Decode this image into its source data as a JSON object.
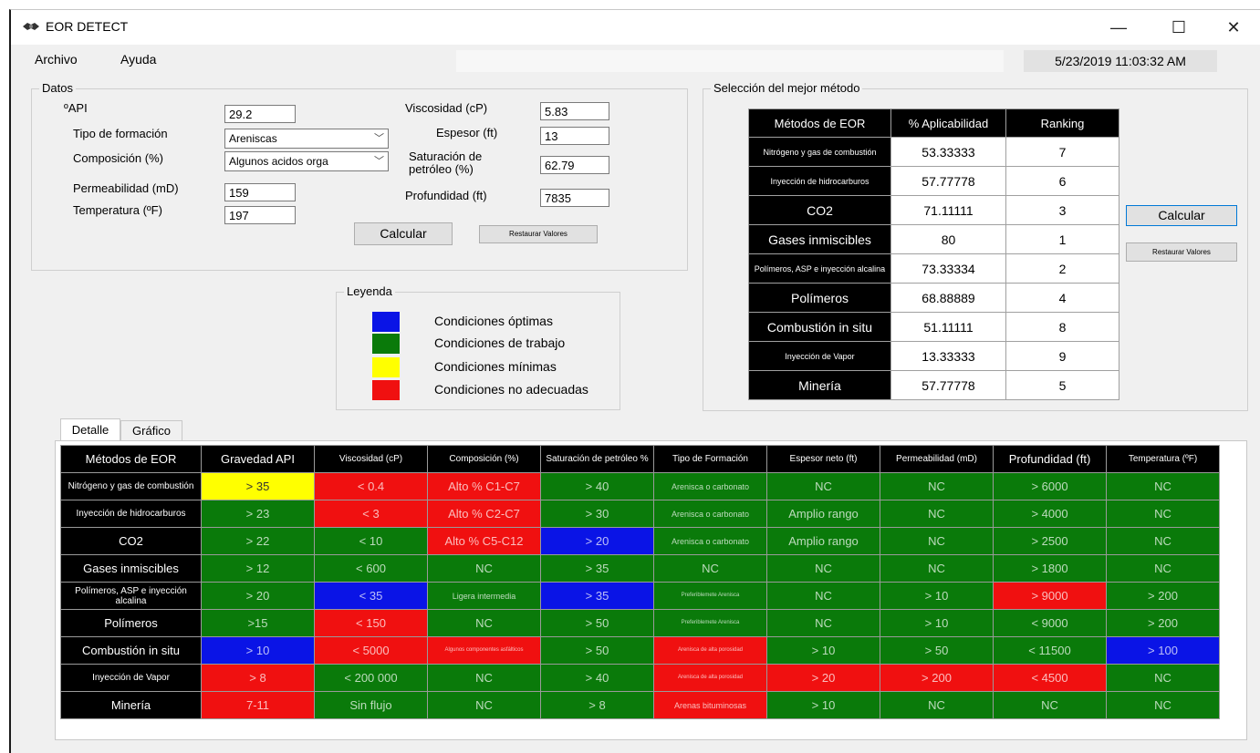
{
  "window": {
    "title": "EOR DETECT",
    "minimize": "—",
    "maximize": "☐",
    "close": "✕"
  },
  "menu": {
    "archivo": "Archivo",
    "ayuda": "Ayuda"
  },
  "datetime": "5/23/2019 11:03:32 AM",
  "datos": {
    "title": "Datos",
    "api_label": "ºAPI",
    "api_value": "29.2",
    "tipo_label": "Tipo de formación",
    "tipo_value": "Areniscas",
    "comp_label": "Composición (%)",
    "comp_value": "Algunos acidos orga",
    "perm_label": "Permeabilidad (mD)",
    "perm_value": "159",
    "temp_label": "Temperatura (ºF)",
    "temp_value": "197",
    "visc_label": "Viscosidad (cP)",
    "visc_value": "5.83",
    "esp_label": "Espesor (ft)",
    "esp_value": "13",
    "sat_label_1": "Saturación de",
    "sat_label_2": "petróleo (%)",
    "sat_value": "62.79",
    "prof_label": "Profundidad (ft)",
    "prof_value": "7835",
    "calcular": "Calcular",
    "restaurar": "Restaurar Valores"
  },
  "leyenda": {
    "title": "Leyenda",
    "items": [
      {
        "color": "#0a14e6",
        "label": "Condiciones óptimas"
      },
      {
        "color": "#0a7a0a",
        "label": "Condiciones de trabajo"
      },
      {
        "color": "#ffff00",
        "label": "Condiciones mínimas"
      },
      {
        "color": "#f01010",
        "label": "Condiciones no adecuadas"
      }
    ]
  },
  "seleccion": {
    "title": "Selección del mejor método",
    "headers": [
      "Métodos de EOR",
      "% Aplicabilidad",
      "Ranking"
    ],
    "rows": [
      {
        "method": "Nitrógeno y gas de combustión",
        "pct": "53.33333",
        "rank": "7",
        "small": true
      },
      {
        "method": "Inyección de hidrocarburos",
        "pct": "57.77778",
        "rank": "6",
        "small": true
      },
      {
        "method": "CO2",
        "pct": "71.11111",
        "rank": "3",
        "small": false
      },
      {
        "method": "Gases inmiscibles",
        "pct": "80",
        "rank": "1",
        "small": false
      },
      {
        "method": "Polímeros, ASP e inyección alcalina",
        "pct": "73.33334",
        "rank": "2",
        "small": true
      },
      {
        "method": "Polímeros",
        "pct": "68.88889",
        "rank": "4",
        "small": false
      },
      {
        "method": "Combustión in situ",
        "pct": "51.11111",
        "rank": "8",
        "small": false
      },
      {
        "method": "Inyección de Vapor",
        "pct": "13.33333",
        "rank": "9",
        "small": true
      },
      {
        "method": "Minería",
        "pct": "57.77778",
        "rank": "5",
        "small": false
      }
    ],
    "calcular": "Calcular",
    "restaurar": "Restaurar Valores"
  },
  "tabs": [
    "Detalle",
    "Gráfico"
  ],
  "detalle": {
    "headers": [
      "Métodos de EOR",
      "Gravedad API",
      "Viscosidad (cP)",
      "Composición (%)",
      "Saturación de petróleo %",
      "Tipo de Formación",
      "Espesor neto (ft)",
      "Permeabilidad (mD)",
      "Profundidad (ft)",
      "Temperatura (ºF)"
    ],
    "rows": [
      {
        "method": "Nitrógeno y gas de combustión",
        "cells": [
          {
            "text": "> 35",
            "color": "y"
          },
          {
            "text": "< 0.4",
            "color": "r"
          },
          {
            "text": "Alto % C1-C7",
            "color": "r"
          },
          {
            "text": "> 40",
            "color": "g"
          },
          {
            "text": "Arenisca o carbonato",
            "color": "g"
          },
          {
            "text": "NC",
            "color": "g"
          },
          {
            "text": "NC",
            "color": "g"
          },
          {
            "text": "> 6000",
            "color": "g"
          },
          {
            "text": "NC",
            "color": "g"
          }
        ]
      },
      {
        "method": "Inyección de hidrocarburos",
        "cells": [
          {
            "text": "> 23",
            "color": "g"
          },
          {
            "text": "< 3",
            "color": "r"
          },
          {
            "text": "Alto % C2-C7",
            "color": "r"
          },
          {
            "text": "> 30",
            "color": "g"
          },
          {
            "text": "Arenisca o carbonato",
            "color": "g"
          },
          {
            "text": "Amplio rango",
            "color": "g"
          },
          {
            "text": "NC",
            "color": "g"
          },
          {
            "text": "> 4000",
            "color": "g"
          },
          {
            "text": "NC",
            "color": "g"
          }
        ]
      },
      {
        "method": "CO2",
        "cells": [
          {
            "text": "> 22",
            "color": "g"
          },
          {
            "text": "< 10",
            "color": "g"
          },
          {
            "text": "Alto % C5-C12",
            "color": "r"
          },
          {
            "text": "> 20",
            "color": "b"
          },
          {
            "text": "Arenisca o carbonato",
            "color": "g"
          },
          {
            "text": "Amplio rango",
            "color": "g"
          },
          {
            "text": "NC",
            "color": "g"
          },
          {
            "text": "> 2500",
            "color": "g"
          },
          {
            "text": "NC",
            "color": "g"
          }
        ]
      },
      {
        "method": "Gases inmiscibles",
        "cells": [
          {
            "text": "> 12",
            "color": "g"
          },
          {
            "text": "< 600",
            "color": "g"
          },
          {
            "text": "NC",
            "color": "g"
          },
          {
            "text": "> 35",
            "color": "g"
          },
          {
            "text": "NC",
            "color": "g"
          },
          {
            "text": "NC",
            "color": "g"
          },
          {
            "text": "NC",
            "color": "g"
          },
          {
            "text": "> 1800",
            "color": "g"
          },
          {
            "text": "NC",
            "color": "g"
          }
        ]
      },
      {
        "method": "Polímeros, ASP e inyección alcalina",
        "cells": [
          {
            "text": "> 20",
            "color": "g"
          },
          {
            "text": "< 35",
            "color": "b"
          },
          {
            "text": "Ligera intermedia",
            "color": "g"
          },
          {
            "text": "> 35",
            "color": "b"
          },
          {
            "text": "Preferiblemete Arenisca",
            "color": "g"
          },
          {
            "text": "NC",
            "color": "g"
          },
          {
            "text": "> 10",
            "color": "g"
          },
          {
            "text": "> 9000",
            "color": "r"
          },
          {
            "text": "> 200",
            "color": "g"
          }
        ]
      },
      {
        "method": "Polímeros",
        "cells": [
          {
            "text": ">15",
            "color": "g"
          },
          {
            "text": "< 150",
            "color": "r"
          },
          {
            "text": "NC",
            "color": "g"
          },
          {
            "text": "> 50",
            "color": "g"
          },
          {
            "text": "Preferiblemete Arenisca",
            "color": "g"
          },
          {
            "text": "NC",
            "color": "g"
          },
          {
            "text": "> 10",
            "color": "g"
          },
          {
            "text": "< 9000",
            "color": "g"
          },
          {
            "text": "> 200",
            "color": "g"
          }
        ]
      },
      {
        "method": "Combustión in situ",
        "cells": [
          {
            "text": "> 10",
            "color": "b"
          },
          {
            "text": "< 5000",
            "color": "r"
          },
          {
            "text": "Algunos componentes asfálticos",
            "color": "r"
          },
          {
            "text": "> 50",
            "color": "g"
          },
          {
            "text": "Arenisca de alta porosidad",
            "color": "r"
          },
          {
            "text": "> 10",
            "color": "g"
          },
          {
            "text": "> 50",
            "color": "g"
          },
          {
            "text": "< 11500",
            "color": "g"
          },
          {
            "text": "> 100",
            "color": "b"
          }
        ]
      },
      {
        "method": "Inyección de Vapor",
        "cells": [
          {
            "text": "> 8",
            "color": "r"
          },
          {
            "text": "< 200 000",
            "color": "g"
          },
          {
            "text": "NC",
            "color": "g"
          },
          {
            "text": "> 40",
            "color": "g"
          },
          {
            "text": "Arenisca de alta porosidad",
            "color": "r"
          },
          {
            "text": "> 20",
            "color": "r"
          },
          {
            "text": "> 200",
            "color": "r"
          },
          {
            "text": "< 4500",
            "color": "r"
          },
          {
            "text": "NC",
            "color": "g"
          }
        ]
      },
      {
        "method": "Minería",
        "cells": [
          {
            "text": "7-11",
            "color": "r"
          },
          {
            "text": "Sin flujo",
            "color": "g"
          },
          {
            "text": "NC",
            "color": "g"
          },
          {
            "text": "> 8",
            "color": "g"
          },
          {
            "text": "Arenas bituminosas",
            "color": "r"
          },
          {
            "text": "> 10",
            "color": "g"
          },
          {
            "text": "NC",
            "color": "g"
          },
          {
            "text": "NC",
            "color": "g"
          },
          {
            "text": "NC",
            "color": "g"
          }
        ]
      }
    ]
  }
}
